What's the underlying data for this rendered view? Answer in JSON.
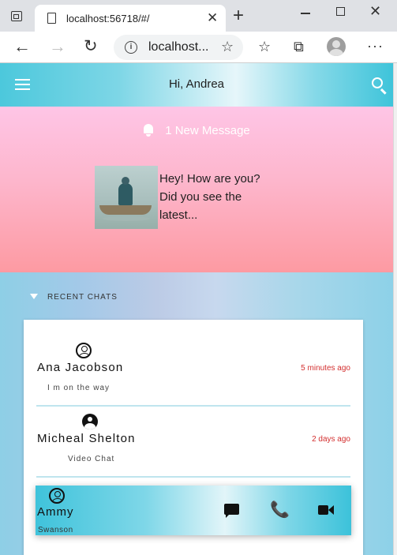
{
  "browser": {
    "tab_title": "localhost:56718/#/",
    "tab_close": "✕",
    "new_tab": "+",
    "window_close": "✕",
    "url": "localhost...",
    "back": "←",
    "forward": "→",
    "reload": "↻",
    "favorites_star": "☆",
    "favorites": "☆",
    "collections": "⧉",
    "more": "···"
  },
  "appbar": {
    "greeting": "Hi, Andrea"
  },
  "new_message": {
    "header": "1 New Message",
    "text": "Hey! How are you? Did you see the latest..."
  },
  "recent_chats": {
    "title": "RECENT CHATS",
    "items": [
      {
        "name": "Ana Jacobson",
        "time": "5 minutes ago",
        "preview": "I m on the way",
        "avatar": "account-circle-outline-icon"
      },
      {
        "name": "Micheal Shelton",
        "time": "2 days ago",
        "preview": "Video Chat",
        "avatar": "account-circle-filled-icon"
      }
    ]
  },
  "active_chat": {
    "name": "Ammy",
    "subtitle": "Swanson",
    "actions": [
      "chat-icon",
      "phone-icon",
      "video-call-icon"
    ],
    "phone_glyph": "📞"
  },
  "colors": {
    "accent_cyan": "#4cc8dc",
    "message_pink": "#fdb6cc",
    "time_red": "#d32f2f"
  }
}
